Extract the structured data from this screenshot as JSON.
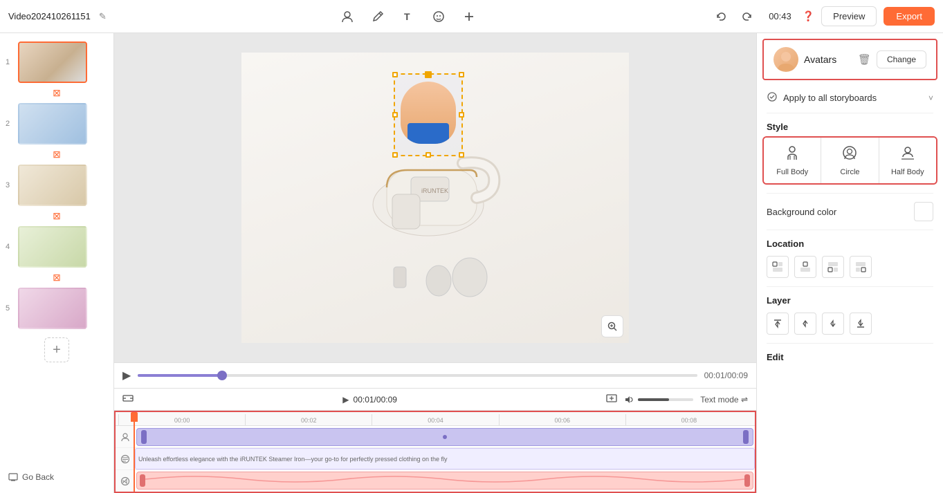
{
  "topbar": {
    "title": "Video202410261151",
    "edit_icon": "✎",
    "timer": "00:43",
    "preview_label": "Preview",
    "export_label": "Export",
    "toolbar_icons": [
      "person-icon",
      "brush-icon",
      "text-icon",
      "face-icon",
      "plus-icon"
    ]
  },
  "left_panel": {
    "storyboards": [
      {
        "number": "1",
        "active": true
      },
      {
        "number": "2",
        "active": false
      },
      {
        "number": "3",
        "active": false
      },
      {
        "number": "4",
        "active": false
      },
      {
        "number": "5",
        "active": false
      }
    ],
    "add_button_label": "+",
    "go_back_label": "Go Back"
  },
  "canvas": {
    "zoom_icon": "⊕",
    "time_current": "00:01",
    "time_total": "00:09"
  },
  "playbar": {
    "play_icon": "▶",
    "time_display": "00:01/00:09"
  },
  "timeline_controls": {
    "fit_icon": "⊞",
    "play_icon": "▶",
    "time_display": "00:01/00:09",
    "thumb_icon": "🖼",
    "text_mode_label": "Text mode",
    "settings_icon": "⇌"
  },
  "timeline": {
    "ruler_marks": [
      "00:00",
      "00:02",
      "00:04",
      "00:06",
      "00:08"
    ],
    "track_icons": [
      "👤",
      "⊙",
      "🎵"
    ],
    "text_track_content": "Unleash effortless elegance with the iRUNTEK Steamer   Iron—your go-to for perfectly pressed clothing on   the fly",
    "audio_track_clips": [
      "",
      ""
    ]
  },
  "right_panel": {
    "avatar_label": "Avatars",
    "delete_icon": "🗑",
    "change_label": "Change",
    "apply_label": "Apply to all storyboards",
    "chevron_icon": "˅",
    "style_section_title": "Style",
    "style_options": [
      {
        "icon": "👤",
        "label": "Full Body"
      },
      {
        "icon": "○",
        "label": "Circle"
      },
      {
        "icon": "👤",
        "label": "Half Body"
      }
    ],
    "bg_color_section_title": "Background color",
    "location_section_title": "Location",
    "location_icons": [
      "⊟",
      "⊟",
      "⊟",
      "⊟"
    ],
    "layer_section_title": "Layer",
    "layer_icons": [
      "⬆",
      "⇑",
      "⇓",
      "⬇"
    ],
    "edit_section_title": "Edit"
  }
}
